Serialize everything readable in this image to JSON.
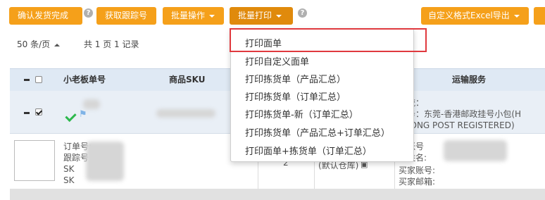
{
  "toolbar": {
    "confirm_shipping": "确认发货完成",
    "get_tracking": "获取跟踪号",
    "batch_ops": "批量操作",
    "batch_print": "批量打印",
    "custom_export": "自定义格式Excel导出",
    "help": "?"
  },
  "pager": {
    "per_page": "50 条/页",
    "total": "共 1 页 1 记录"
  },
  "table": {
    "headers": {
      "order_no": "小老板单号",
      "sku": "商品SKU",
      "shipping": "运输服务"
    },
    "group": {
      "shipping_label": "物流：",
      "service": "服务：东莞-香港邮政挂号小包(H",
      "service_en": "GKONG POST REGISTERED)"
    },
    "detail": {
      "order_label": "订单号:",
      "tracking_label": "跟踪号",
      "sku1": "SK",
      "sku2": "SK",
      "qty": "2",
      "warehouse": "(默认仓库)",
      "buyer_account": "家账号",
      "buyer_name": "家姓名:",
      "buyer_account2": "买家账号:",
      "buyer_email": "买家邮箱:"
    }
  },
  "print_menu": {
    "items": [
      "打印面单",
      "打印自定义面单",
      "打印拣货单（产品汇总）",
      "打印拣货单（订单汇总）",
      "打印拣货单-新（订单汇总）",
      "打印拣货单（产品汇总+订单汇总）",
      "打印面单+拣货单（订单汇总）"
    ]
  },
  "colors": {
    "accent": "#f5a01a",
    "highlight": "#e0393e",
    "header_bg": "#dfe9f4"
  }
}
